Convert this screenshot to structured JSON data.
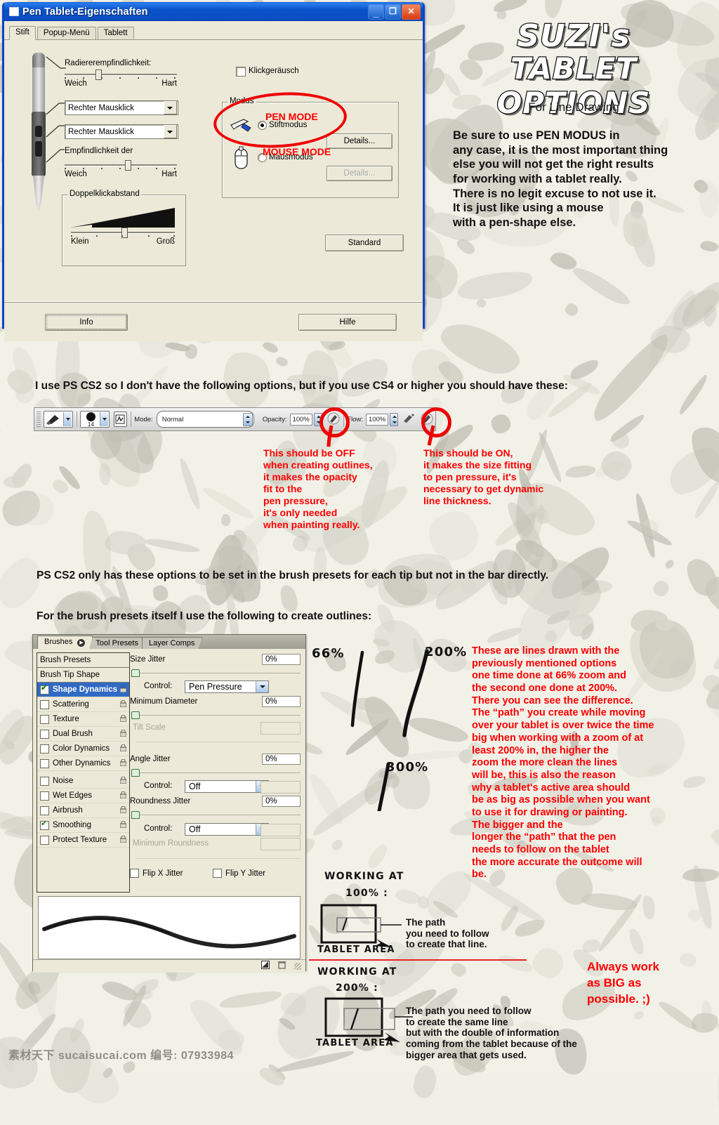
{
  "dialog": {
    "title": "Pen Tablet-Eigenschaften",
    "window_buttons": {
      "minimize": "_",
      "maximize": "❐",
      "close": "✕"
    },
    "tabs": [
      {
        "label": "Stift",
        "active": true
      },
      {
        "label": "Popup-Menü",
        "active": false
      },
      {
        "label": "Tablett",
        "active": false
      }
    ],
    "eraser": {
      "label": "Radiererempfindlichkeit:",
      "min_label": "Weich",
      "max_label": "Hart"
    },
    "button_combos": [
      {
        "value": "Rechter Mausklick"
      },
      {
        "value": "Rechter Mausklick"
      }
    ],
    "sensitivity": {
      "label": "Empfindlichkeit der",
      "min_label": "Weich",
      "max_label": "Hart"
    },
    "doubleclick": {
      "label": "Doppelklickabstand",
      "min_label": "Klein",
      "max_label": "Groß"
    },
    "clicksound": {
      "label": "Klickgeräusch",
      "checked": false
    },
    "modus": {
      "group_label": "Modus",
      "pen_label": "Stiftmodus",
      "pen_selected": true,
      "mouse_label": "Mausmodus",
      "mouse_selected": false,
      "details_pen": "Details...",
      "details_mouse": "Details..."
    },
    "buttons": {
      "standard": "Standard",
      "info": "Info",
      "hilfe": "Hilfe"
    },
    "annotations": {
      "pen_mode": "PEN MODE",
      "mouse_mode": "MOUSE MODE"
    }
  },
  "hero": {
    "title_line1": "SUZI's",
    "title_line2": "TABLET OPTIONS",
    "subtitle": "For Line Drawing",
    "body": "Be sure to use PEN MODUS in\nany case, it is the most important thing\nelse you will not get the right results\nfor working with a tablet really.\nThere is no legit excuse to not use it.\nIt is just like using a mouse\nwith a pen-shape else."
  },
  "middle": {
    "intro": "I use PS CS2 so I don't have the following options, but if you use CS4 or higher you should have these:",
    "cs2_note": "PS CS2 only has these options to be set in the brush presets for each tip but not in the bar directly.",
    "presets_note": "For the brush presets itself I use the following to create outlines:"
  },
  "toolbar": {
    "brush_size": "14",
    "mode_label": "Mode:",
    "mode_value": "Normal",
    "opacity_label": "Opacity:",
    "opacity_value": "100%",
    "flow_label": "Flow:",
    "flow_value": "100%"
  },
  "toolbar_annotations": {
    "off_note": "This should be OFF\nwhen creating outlines,\nit makes the opacity\nfit to the\npen pressure,\nit's only needed\nwhen painting really.",
    "on_note": "This should be ON,\nit makes the size fitting\nto pen pressure, it's\nnecessary to get dynamic\nline thickness."
  },
  "brushes_panel": {
    "tabs": [
      {
        "label": "Brushes",
        "active": true
      },
      {
        "label": "Tool Presets",
        "active": false
      },
      {
        "label": "Layer Comps",
        "active": false
      }
    ],
    "list": [
      {
        "label": "Brush Presets",
        "type": "header"
      },
      {
        "label": "Brush Tip Shape",
        "type": "header"
      },
      {
        "label": "Shape Dynamics",
        "type": "check",
        "checked": true,
        "selected": true
      },
      {
        "label": "Scattering",
        "type": "check",
        "checked": false
      },
      {
        "label": "Texture",
        "type": "check",
        "checked": false
      },
      {
        "label": "Dual Brush",
        "type": "check",
        "checked": false
      },
      {
        "label": "Color Dynamics",
        "type": "check",
        "checked": false
      },
      {
        "label": "Other Dynamics",
        "type": "check",
        "checked": false
      },
      {
        "label": "Noise",
        "type": "check",
        "checked": false
      },
      {
        "label": "Wet Edges",
        "type": "check",
        "checked": false
      },
      {
        "label": "Airbrush",
        "type": "check",
        "checked": false
      },
      {
        "label": "Smoothing",
        "type": "check",
        "checked": true
      },
      {
        "label": "Protect Texture",
        "type": "check",
        "checked": false
      }
    ],
    "size_jitter": {
      "label": "Size Jitter",
      "value": "0%"
    },
    "size_control": {
      "label": "Control:",
      "value": "Pen Pressure"
    },
    "minimum_diameter": {
      "label": "Minimum Diameter",
      "value": "0%"
    },
    "tilt_scale": {
      "label": "Tilt Scale",
      "value": ""
    },
    "angle_jitter": {
      "label": "Angle Jitter",
      "value": "0%"
    },
    "angle_control": {
      "label": "Control:",
      "value": "Off"
    },
    "roundness_jitter": {
      "label": "Roundness Jitter",
      "value": "0%"
    },
    "roundness_control": {
      "label": "Control:",
      "value": "Off"
    },
    "minimum_roundness": {
      "label": "Minimum Roundness",
      "value": ""
    },
    "flip_x": {
      "label": "Flip X Jitter",
      "checked": false
    },
    "flip_y": {
      "label": "Flip Y Jitter",
      "checked": false
    }
  },
  "line_samples": {
    "zoom_66": "66%",
    "zoom_200": "200%",
    "zoom_300": "300%"
  },
  "right_note": "These are lines drawn with the\npreviously mentioned options\none time done at 66% zoom and\nthe second one done at 200%.\nThere you can see the difference.\nThe “path” you create while moving\nover your tablet is over twice the time\nbig when working with a zoom of at\nleast 200% in, the higher the\nzoom the more clean the lines\nwill be, this is also the reason\nwhy a tablet's active area should\nbe as big as possible when you want\nto use it for drawing or painting.\nThe bigger and the\nlonger the “path” that the pen\nneeds to follow on the tablet\nthe more accurate the outcome will\nbe.",
  "diagram_100": {
    "heading_line1": "WORKING AT",
    "heading_line2": "100% :",
    "area_label": "TABLET AREA",
    "note": "The path\nyou need to follow\nto create that line."
  },
  "diagram_200": {
    "heading_line1": "WORKING AT",
    "heading_line2": "200% :",
    "area_label": "TABLET AREA",
    "note": "The path you need to follow\nto create the same line\nbut with the double of information\ncoming from the tablet because of the\nbigger area that gets used."
  },
  "final_note": "Always work\nas BIG as\npossible. ;)",
  "watermark": "素材天下 sucaisucai.com  编号: 07933984",
  "colors": {
    "annotation_red": "#ff0000",
    "title_bar_blue": "#0a50c8",
    "dialog_face": "#ece9d8",
    "selection_blue": "#316ac5",
    "background": "#f2f1e8"
  }
}
